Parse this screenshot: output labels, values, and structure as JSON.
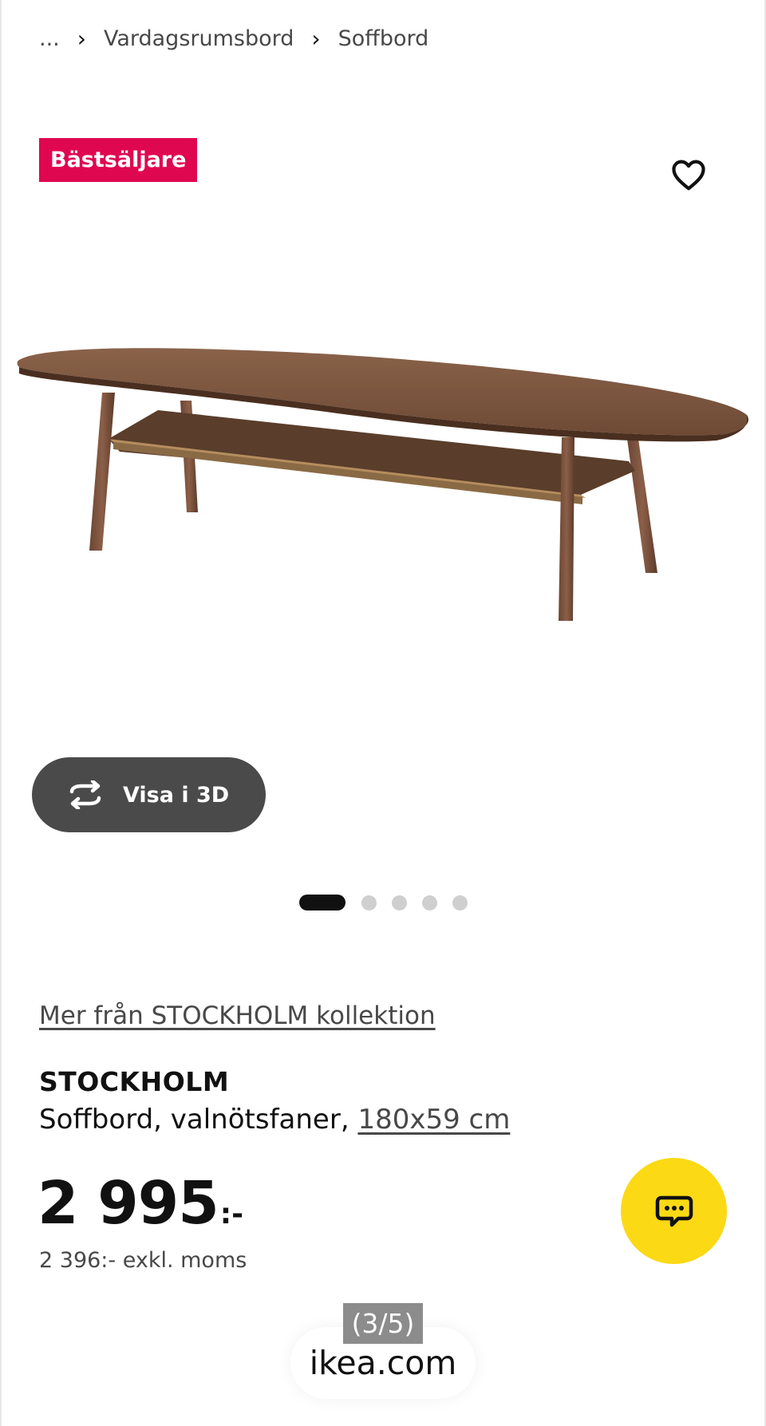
{
  "breadcrumb": {
    "ellipsis": "...",
    "items": [
      "Vardagsrumsbord",
      "Soffbord"
    ]
  },
  "badge": {
    "label": "Bästsäljare",
    "color": "#e00751"
  },
  "favorite": {
    "icon": "heart-icon"
  },
  "view_3d": {
    "label": "Visa i 3D",
    "icon": "rotate-3d-icon"
  },
  "carousel": {
    "total": 5,
    "active_index": 1
  },
  "collection_link": "Mer från STOCKHOLM kollektion",
  "product": {
    "name": "STOCKHOLM",
    "description": "Soffbord, valnötsfaner, ",
    "size": "180x59 cm"
  },
  "price": {
    "amount": "2 995",
    "suffix": ":-",
    "excl_vat": "2 396:- exkl. moms"
  },
  "chat": {
    "icon": "chat-icon",
    "color": "#fbd914"
  },
  "overlay": {
    "counter": "(3/5)",
    "domain": "ikea.com"
  }
}
